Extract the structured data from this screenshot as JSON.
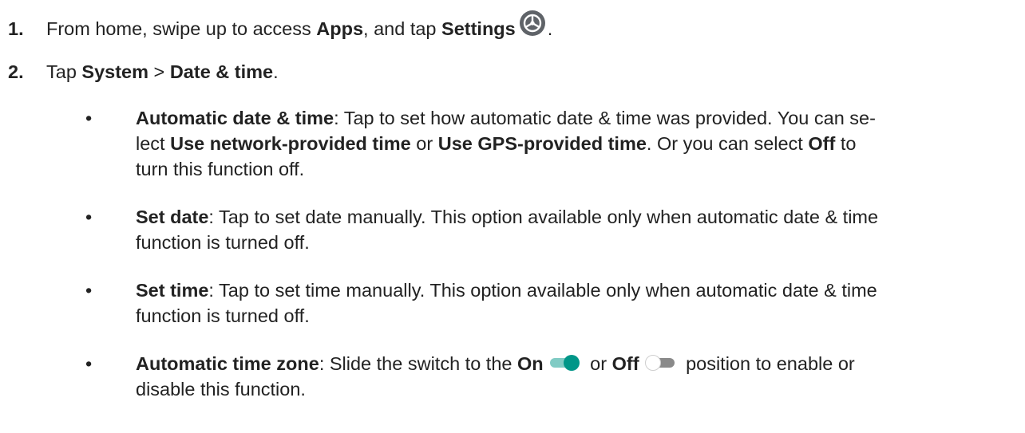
{
  "steps": [
    {
      "num": "1.",
      "t1": "From home, swipe up to access ",
      "b1": "Apps",
      "t2": ", and tap ",
      "b2": "Settings",
      "t3": "."
    },
    {
      "num": "2.",
      "t1": "Tap ",
      "b1": "System",
      "t2": " > ",
      "b2": "Date & time",
      "t3": "."
    }
  ],
  "bullets": {
    "symbol": "•",
    "auto_dt": {
      "title": "Automatic date & time",
      "l1_rest": ": Tap to set how automatic date & time was provided. You can se-",
      "l2_a": "lect ",
      "l2_b": "Use network-provided time",
      "l2_c": " or ",
      "l2_d": "Use GPS-provided time",
      "l2_e": ". Or you can select ",
      "l2_f": "Off",
      "l2_g": " to",
      "l3": "turn this function off."
    },
    "set_date": {
      "title": "Set date",
      "l1_rest": ": Tap to set date manually. This option available only when automatic date & time",
      "l2": "function is turned off."
    },
    "set_time": {
      "title": "Set time",
      "l1_rest": ": Tap to set time manually. This option available only when automatic date & time",
      "l2": "function is turned off."
    },
    "auto_tz": {
      "title": "Automatic time zone",
      "l1_a": ": Slide the switch to the ",
      "l1_on": "On",
      "l1_or": " or ",
      "l1_off": "Off",
      "l1_rest": " position to enable or",
      "l2": "disable this function."
    }
  },
  "icons": {
    "settings": "settings-gear-icon",
    "toggle_on": "toggle-on-icon",
    "toggle_off": "toggle-off-icon"
  },
  "colors": {
    "text": "#222222",
    "settings_icon_bg": "#5f6368",
    "toggle_on_track": "#80cbc4",
    "toggle_on_thumb": "#009688",
    "toggle_off_track": "#8a8a8a",
    "toggle_off_thumb": "#ffffff"
  }
}
